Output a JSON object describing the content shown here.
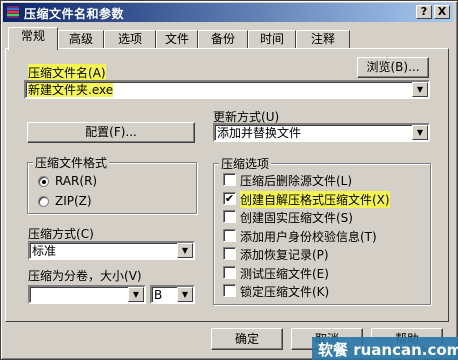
{
  "window": {
    "title": "压缩文件名和参数",
    "help_btn": "?",
    "close_btn": "X"
  },
  "tabs": [
    {
      "label": "常规",
      "active": true
    },
    {
      "label": "高级"
    },
    {
      "label": "选项"
    },
    {
      "label": "文件"
    },
    {
      "label": "备份"
    },
    {
      "label": "时间"
    },
    {
      "label": "注释"
    }
  ],
  "archive_name": {
    "label": "压缩文件名",
    "hotkey": "(A)",
    "value": "新建文件夹.exe",
    "browse_button": "浏览(B)..."
  },
  "update_mode": {
    "label": "更新方式",
    "hotkey": "(U)",
    "value": "添加并替换文件"
  },
  "profiles_button": "配置(F)...",
  "archive_format": {
    "title": "压缩文件格式",
    "options": [
      {
        "label": "RAR(R)",
        "selected": true
      },
      {
        "label": "ZIP(Z)",
        "selected": false
      }
    ]
  },
  "compression_method": {
    "label": "压缩方式",
    "hotkey": "(C)",
    "value": "标准"
  },
  "split_volumes": {
    "label": "压缩为分卷，大小",
    "hotkey": "(V)",
    "value": "",
    "unit": "B"
  },
  "archive_options": {
    "title": "压缩选项",
    "items": [
      {
        "label": "压缩后删除源文件(L)",
        "checked": false
      },
      {
        "label": "创建自解压格式压缩文件(X)",
        "checked": true,
        "highlight": true
      },
      {
        "label": "创建固实压缩文件(S)",
        "checked": false
      },
      {
        "label": "添加用户身份校验信息(T)",
        "checked": false
      },
      {
        "label": "添加恢复记录(P)",
        "checked": false
      },
      {
        "label": "测试压缩文件(E)",
        "checked": false
      },
      {
        "label": "锁定压缩文件(K)",
        "checked": false
      }
    ]
  },
  "footer": {
    "ok": "确定",
    "cancel": "取消",
    "help": "帮助"
  },
  "watermark": "软餐 ruancan.com",
  "colors": {
    "title_start": "#0a246a",
    "title_end": "#a6caf0",
    "highlight": "#f5f552",
    "dialog_bg": "#d4d0c8",
    "watermark_bg": "#2a77a8"
  }
}
